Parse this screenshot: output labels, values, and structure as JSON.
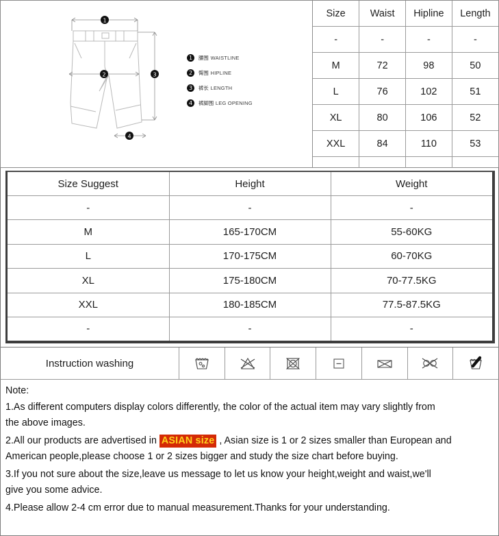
{
  "diagram": {
    "alt": "mens shorts technical drawing with numbered measurement callouts",
    "markers": [
      "1",
      "2",
      "3",
      "4"
    ],
    "legend": [
      {
        "num": "1",
        "cn": "腰围",
        "en": "WAISTLINE"
      },
      {
        "num": "2",
        "cn": "臀围",
        "en": "HIPLINE"
      },
      {
        "num": "3",
        "cn": "裤长",
        "en": "LENGTH"
      },
      {
        "num": "4",
        "cn": "裤脚围",
        "en": "LEG OPENING"
      }
    ]
  },
  "size_table": {
    "headers": [
      "Size",
      "Waist",
      "Hipline",
      "Length"
    ],
    "rows": [
      [
        "-",
        "-",
        "-",
        "-"
      ],
      [
        "M",
        "72",
        "98",
        "50"
      ],
      [
        "L",
        "76",
        "102",
        "51"
      ],
      [
        "XL",
        "80",
        "106",
        "52"
      ],
      [
        "XXL",
        "84",
        "110",
        "53"
      ],
      [
        "-",
        "-",
        "-",
        "-"
      ]
    ]
  },
  "suggest_table": {
    "headers": [
      "Size Suggest",
      "Height",
      "Weight"
    ],
    "rows": [
      [
        "-",
        "-",
        "-"
      ],
      [
        "M",
        "165-170CM",
        "55-60KG"
      ],
      [
        "L",
        "170-175CM",
        "60-70KG"
      ],
      [
        "XL",
        "175-180CM",
        "70-77.5KG"
      ],
      [
        "XXL",
        "180-185CM",
        "77.5-87.5KG"
      ],
      [
        "-",
        "-",
        "-"
      ]
    ]
  },
  "washing": {
    "label": "Instruction washing",
    "icons": [
      "hand-wash-icon",
      "do-not-bleach-icon",
      "do-not-tumble-dry-icon",
      "dry-flat-icon",
      "do-not-iron-icon",
      "do-not-dry-clean-icon",
      "do-not-wring-icon"
    ]
  },
  "note": {
    "title": "Note:",
    "line1a": "1.As different computers display colors differently, the color of the actual item may vary slightly from",
    "line1b": "the above images.",
    "line2a": "2.All our products are advertised in ",
    "line2_highlight": "ASIAN size",
    "line2b": " , Asian size is 1 or 2 sizes smaller than European and",
    "line2c": "American people,please choose 1 or 2 sizes bigger and study the size chart before buying.",
    "line3a": "3.If you not sure about the size,leave us message to let us know your height,weight and waist,we'll",
    "line3b": "give you some advice.",
    "line4": "4.Please allow 2-4 cm error due to manual measurement.Thanks for your understanding."
  },
  "colors": {
    "highlight_bg": "#d42a06",
    "highlight_fg": "#ffd21e",
    "border": "#8c8c8c",
    "heavy_border": "#3d3d3d"
  }
}
